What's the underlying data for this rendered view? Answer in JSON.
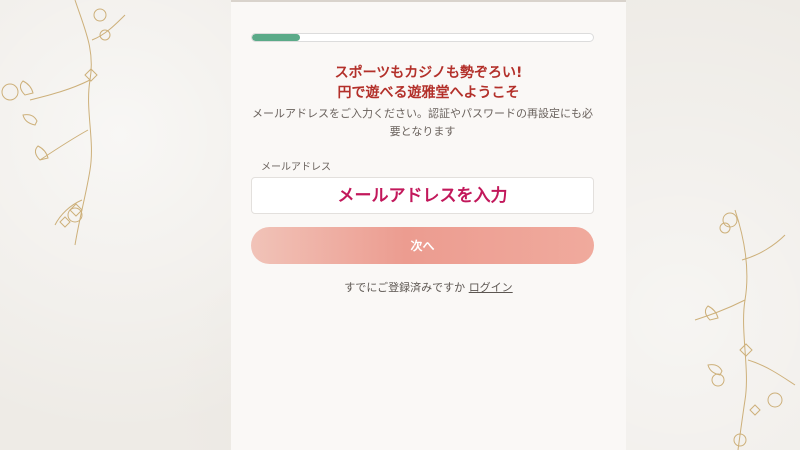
{
  "progress": {
    "value_percent": 14,
    "color": "#5aaa88"
  },
  "headline": {
    "line1": "スポーツもカジノも勢ぞろい!",
    "line2": "円で遊べる遊雅堂へようこそ"
  },
  "description": "メールアドレスをご入力ください。認証やパスワードの再設定にも必要となります",
  "email_field": {
    "label": "メールアドレス",
    "placeholder": "メールアドレスを入力",
    "value": ""
  },
  "next_button": {
    "label": "次へ"
  },
  "login_prompt": {
    "text": "すでにご登録済みですか",
    "link_label": "ログイン"
  },
  "colors": {
    "headline": "#b3302a",
    "input_text": "#c2185b",
    "button": "#ec9c90"
  }
}
